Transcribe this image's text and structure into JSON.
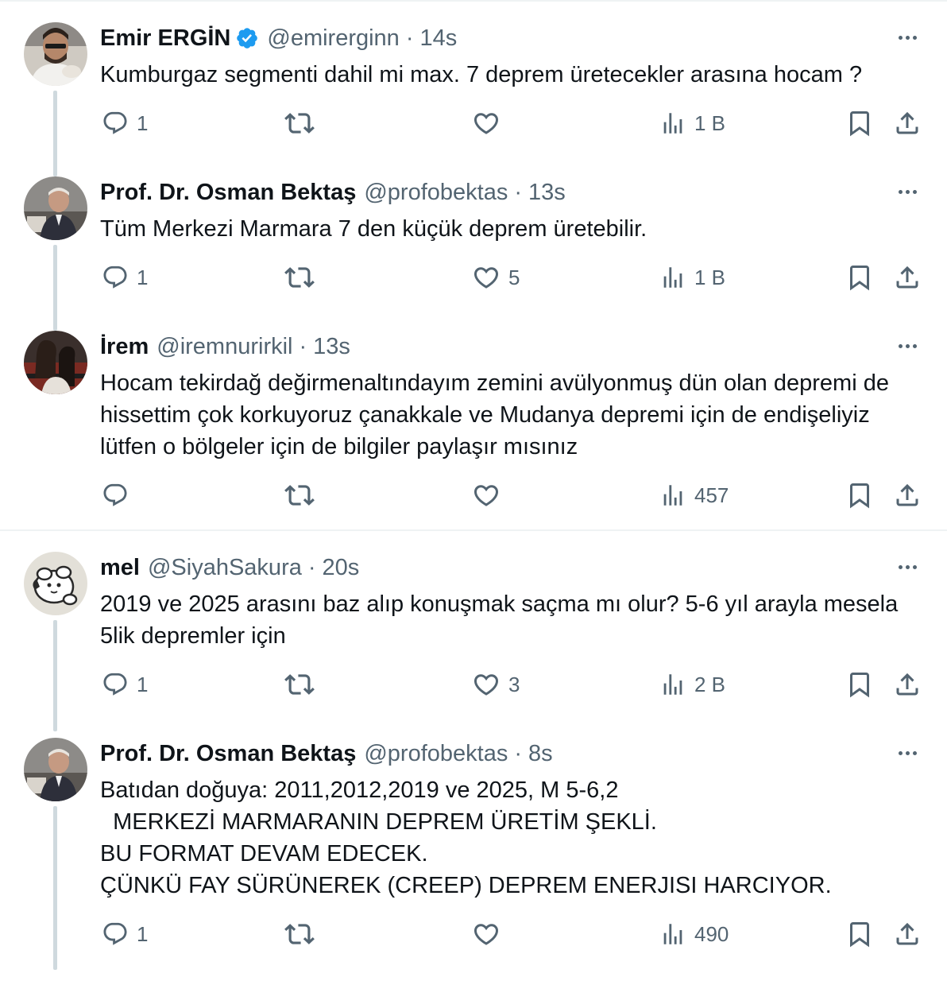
{
  "tweets": [
    {
      "name": "Emir ERGİN",
      "verified": true,
      "handle": "@emirerginn",
      "time": "14s",
      "text": "Kumburgaz segmenti dahil mi max. 7 deprem üretecekler arasına hocam ?",
      "replies": "1",
      "retweets": "",
      "likes": "",
      "views": "1 B"
    },
    {
      "name": "Prof. Dr. Osman Bektaş",
      "verified": false,
      "handle": "@profobektas",
      "time": "13s",
      "text": "Tüm Merkezi Marmara 7 den küçük deprem üretebilir.",
      "replies": "1",
      "retweets": "",
      "likes": "5",
      "views": "1 B"
    },
    {
      "name": "İrem",
      "verified": false,
      "handle": "@iremnurirkil",
      "time": "13s",
      "text": "Hocam tekirdağ değirmenaltındayım zemini avülyonmuş dün olan depremi de hissettim çok korkuyoruz çanakkale ve Mudanya depremi için de endişeliyiz lütfen o bölgeler için de bilgiler paylaşır mısınız",
      "replies": "",
      "retweets": "",
      "likes": "",
      "views": "457"
    },
    {
      "name": "mel",
      "verified": false,
      "handle": "@SiyahSakura",
      "time": "20s",
      "text": "2019 ve 2025 arasını baz alıp konuşmak saçma mı olur? 5-6 yıl arayla mesela 5lik depremler için",
      "replies": "1",
      "retweets": "",
      "likes": "3",
      "views": "2 B"
    },
    {
      "name": "Prof. Dr. Osman Bektaş",
      "verified": false,
      "handle": "@profobektas",
      "time": "8s",
      "text": "Batıdan doğuya: 2011,2012,2019 ve 2025, M 5-6,2\n  MERKEZİ MARMARANIN DEPREM ÜRETİM ŞEKLİ.\nBU FORMAT DEVAM EDECEK.\nÇÜNKÜ FAY SÜRÜNEREK (CREEP) DEPREM ENERJISI HARCIYOR.",
      "replies": "1",
      "retweets": "",
      "likes": "",
      "views": "490"
    }
  ],
  "icons": {
    "verified": "verified-badge-icon",
    "reply": "reply-icon",
    "retweet": "retweet-icon",
    "like": "like-icon",
    "views": "views-icon",
    "bookmark": "bookmark-icon",
    "share": "share-icon",
    "more": "more-icon"
  },
  "colors": {
    "text": "#0f1419",
    "secondary": "#536471",
    "verified": "#1d9bf0",
    "thread_line": "#cfd9de",
    "divider": "#eff3f4"
  }
}
